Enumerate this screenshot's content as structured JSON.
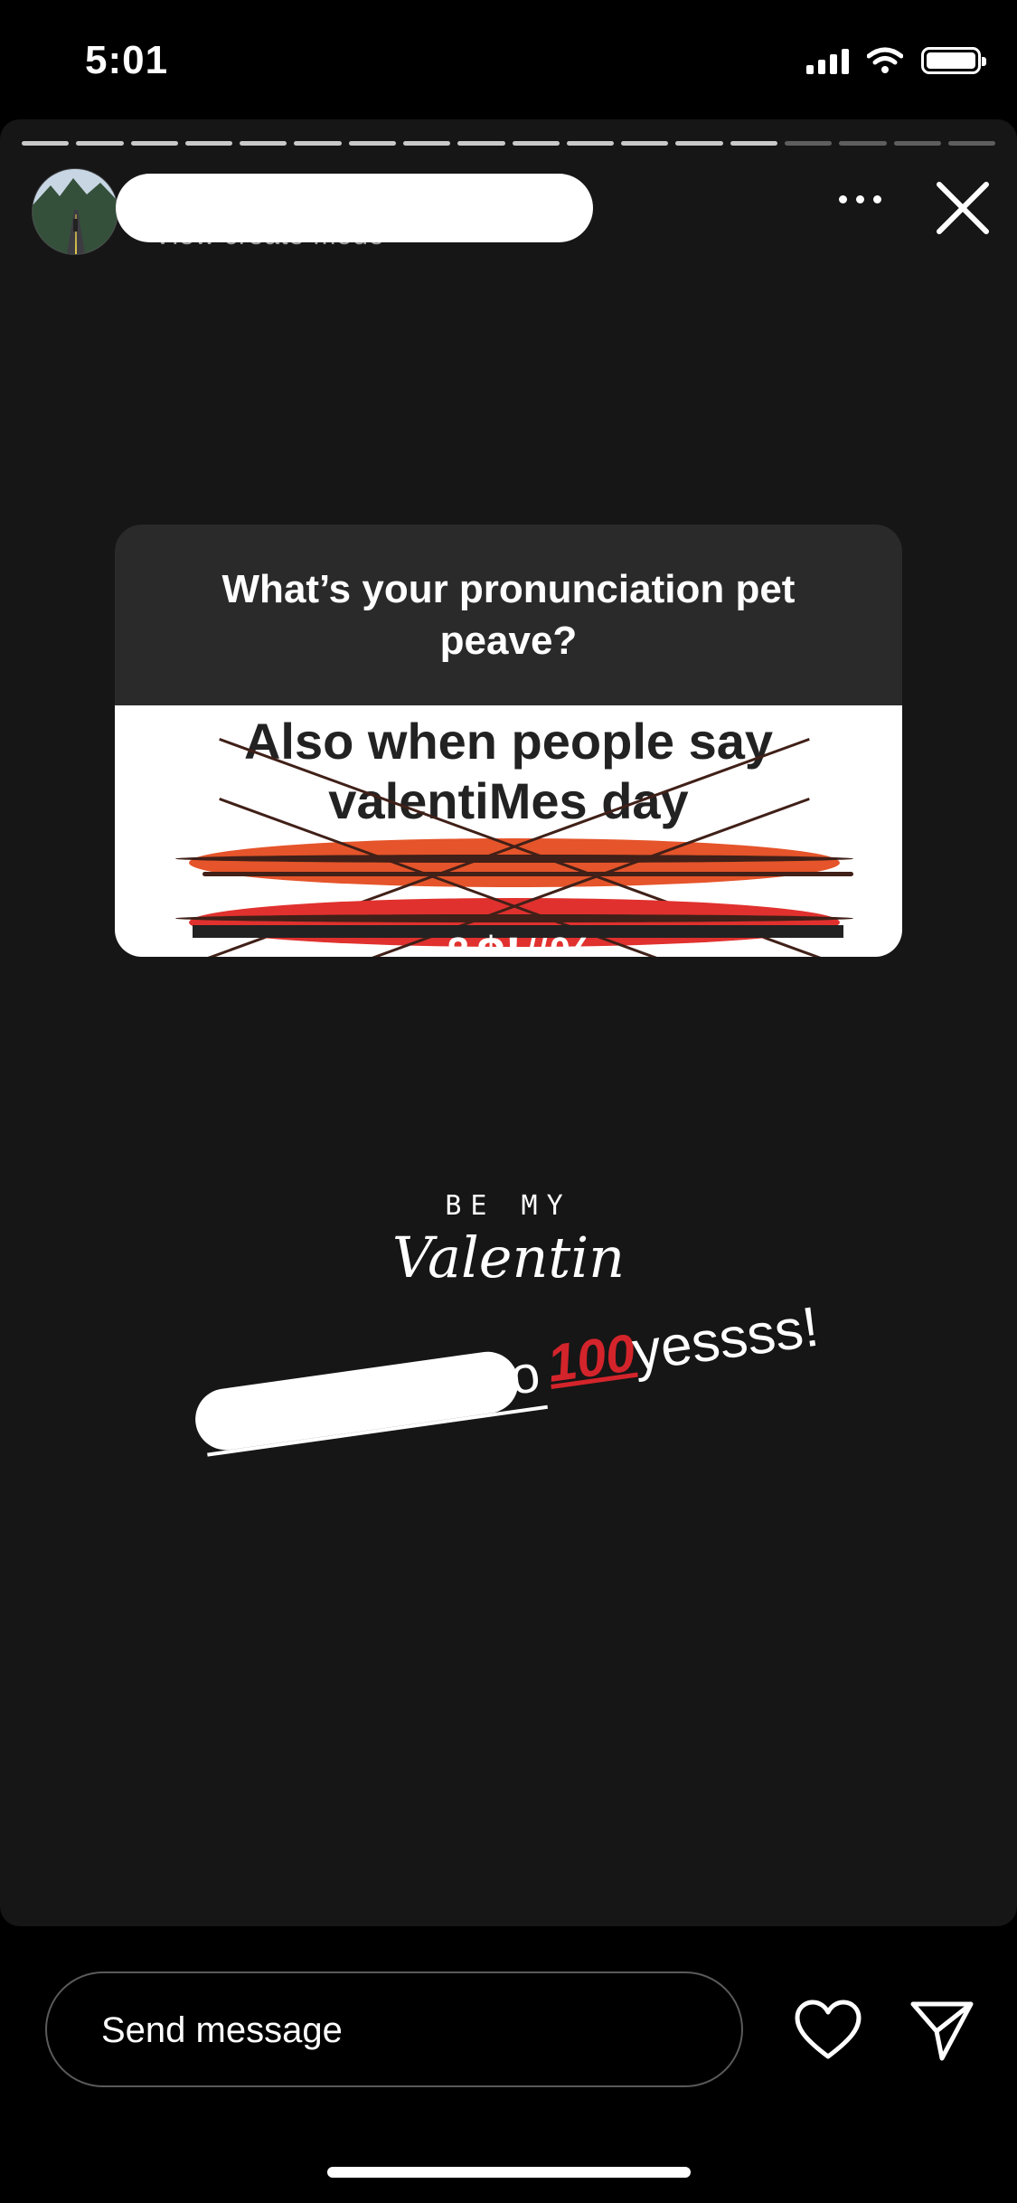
{
  "status_bar": {
    "time": "5:01"
  },
  "story": {
    "progress_segments": [
      true,
      true,
      true,
      true,
      true,
      true,
      true,
      true,
      true,
      true,
      true,
      true,
      true,
      true,
      false,
      false,
      false,
      false
    ],
    "username": "[redacted]",
    "subtitle": "View create mode"
  },
  "question_sticker": {
    "question": "What’s your pronunciation pet peave?",
    "answer": "Also when people say valentiMes day",
    "cursing_emoji_symbols": "&$!#%"
  },
  "sticker": {
    "line1": "BE MY",
    "line2": "Valentin"
  },
  "caption": {
    "peek": "o",
    "hundred": "100",
    "text": "yessss!"
  },
  "bottom_bar": {
    "message_placeholder": "Send message"
  },
  "colors": {
    "background": "#000000",
    "story_bg": "#161616",
    "hundred_red": "#d4242b"
  }
}
